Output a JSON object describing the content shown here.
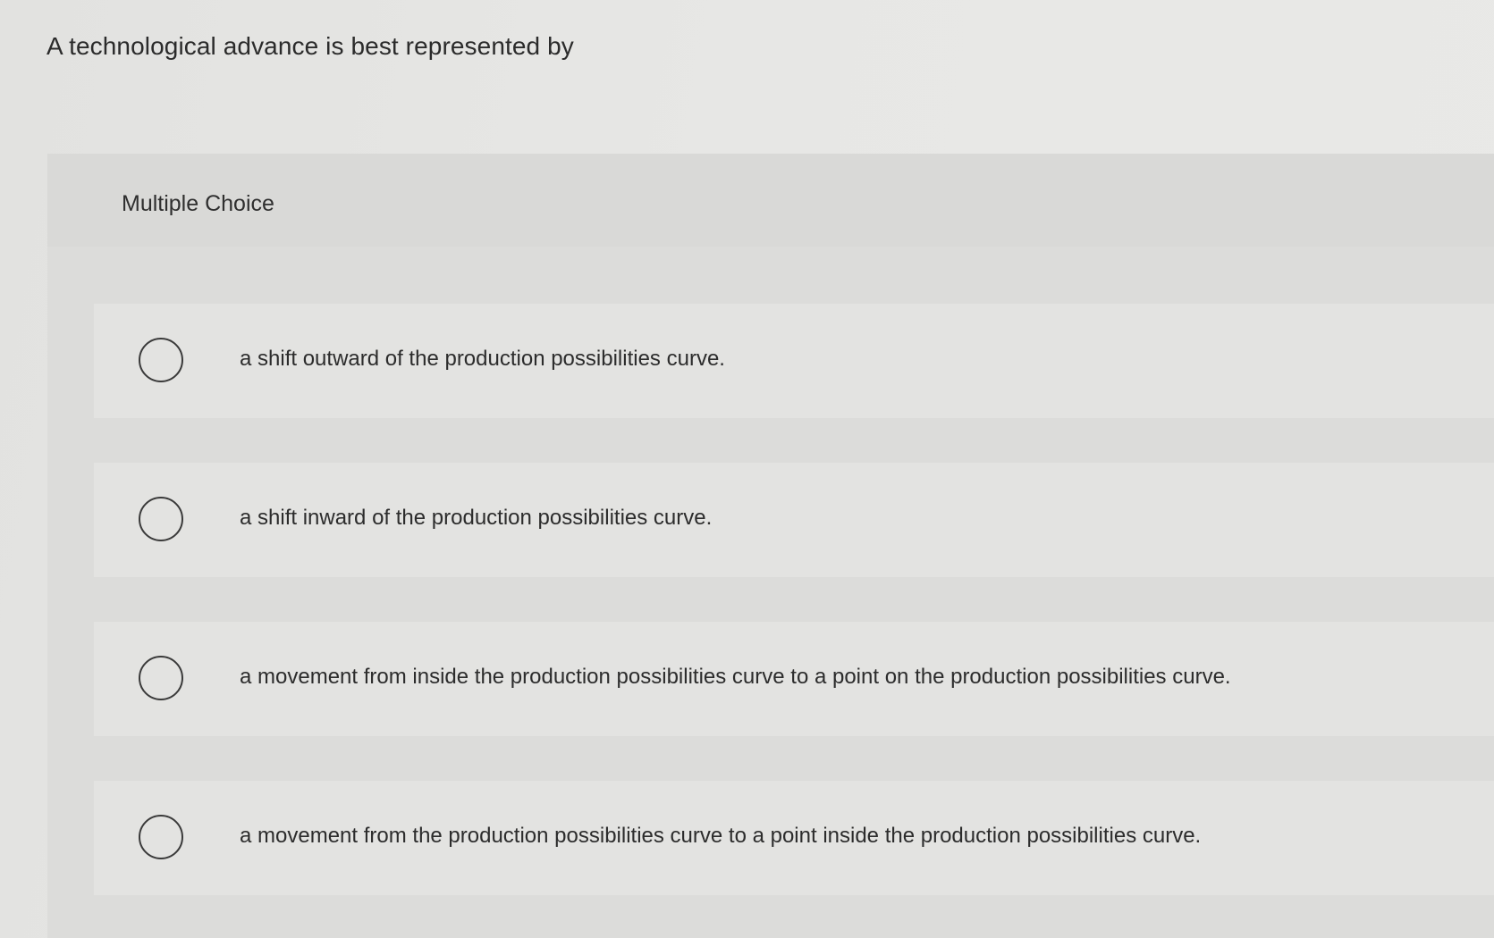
{
  "question": {
    "text": "A technological advance is best represented by"
  },
  "panel": {
    "title": "Multiple Choice"
  },
  "options": [
    {
      "label": "a shift outward of the production possibilities curve.",
      "selected": false
    },
    {
      "label": "a shift inward of the production possibilities curve.",
      "selected": false
    },
    {
      "label": "a movement from inside the production possibilities curve to a point on the production possibilities curve.",
      "selected": false
    },
    {
      "label": "a movement from the production possibilities curve to a point inside the production possibilities curve.",
      "selected": false
    }
  ],
  "colors": {
    "background": "#e4e4e2",
    "panel": "#dcdcda",
    "option_row": "#e3e3e1",
    "text": "#2b2b2b"
  }
}
